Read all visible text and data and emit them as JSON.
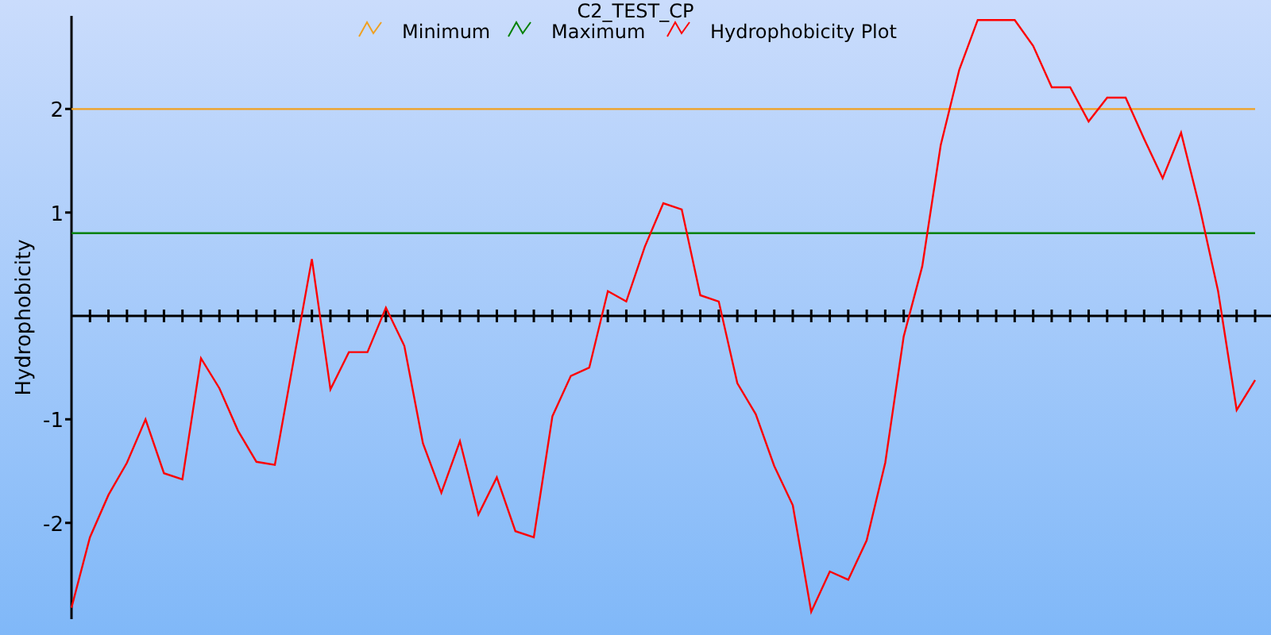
{
  "chart": {
    "chart_data": {
      "type": "line",
      "title": "C2_TEST_CP",
      "ylabel": "Hydrophobicity",
      "categories": [
        null,
        null,
        null,
        null,
        null,
        null,
        null,
        null,
        null,
        null,
        null,
        null,
        null,
        null,
        null,
        null,
        null,
        null,
        null,
        null,
        null,
        null,
        null,
        null,
        null,
        null,
        null,
        null,
        null,
        null,
        null,
        null,
        null,
        null,
        null,
        null,
        null,
        null,
        null,
        null,
        null,
        null,
        null,
        null,
        null,
        null,
        null,
        null,
        null,
        null,
        null,
        null,
        null,
        null,
        null,
        null,
        null,
        null,
        null,
        null,
        null,
        null,
        null,
        null,
        null
      ],
      "ylim": [
        -2.9,
        2.9
      ],
      "legend": "top",
      "yticks": [
        {
          "value": -2,
          "label": "-2"
        },
        {
          "value": -1,
          "label": "-1"
        },
        {
          "value": 1,
          "label": "1"
        },
        {
          "value": 2,
          "label": "2"
        }
      ],
      "series": [
        {
          "name": "Minimum",
          "color": "#f0a020",
          "values": [
            2,
            2,
            2,
            2,
            2,
            2,
            2,
            2,
            2,
            2,
            2,
            2,
            2,
            2,
            2,
            2,
            2,
            2,
            2,
            2,
            2,
            2,
            2,
            2,
            2,
            2,
            2,
            2,
            2,
            2,
            2,
            2,
            2,
            2,
            2,
            2,
            2,
            2,
            2,
            2,
            2,
            2,
            2,
            2,
            2,
            2,
            2,
            2,
            2,
            2,
            2,
            2,
            2,
            2,
            2,
            2,
            2,
            2,
            2,
            2,
            2,
            2,
            2,
            2,
            2
          ]
        },
        {
          "name": "Maximum",
          "color": "#008000",
          "values": [
            0.8,
            0.8,
            0.8,
            0.8,
            0.8,
            0.8,
            0.8,
            0.8,
            0.8,
            0.8,
            0.8,
            0.8,
            0.8,
            0.8,
            0.8,
            0.8,
            0.8,
            0.8,
            0.8,
            0.8,
            0.8,
            0.8,
            0.8,
            0.8,
            0.8,
            0.8,
            0.8,
            0.8,
            0.8,
            0.8,
            0.8,
            0.8,
            0.8,
            0.8,
            0.8,
            0.8,
            0.8,
            0.8,
            0.8,
            0.8,
            0.8,
            0.8,
            0.8,
            0.8,
            0.8,
            0.8,
            0.8,
            0.8,
            0.8,
            0.8,
            0.8,
            0.8,
            0.8,
            0.8,
            0.8,
            0.8,
            0.8,
            0.8,
            0.8,
            0.8,
            0.8,
            0.8,
            0.8,
            0.8,
            0.8
          ]
        },
        {
          "name": "Hydrophobicity Plot",
          "color": "#ff0000",
          "values": [
            -2.82,
            -2.14,
            -1.73,
            -1.42,
            -1.0,
            -1.52,
            -1.58,
            -0.41,
            -0.7,
            -1.11,
            -1.41,
            -1.44,
            -0.44,
            0.55,
            -0.71,
            -0.35,
            -0.35,
            0.08,
            -0.29,
            -1.23,
            -1.71,
            -1.21,
            -1.92,
            -1.56,
            -2.08,
            -2.14,
            -0.97,
            -0.58,
            -0.5,
            0.24,
            0.14,
            0.67,
            1.09,
            1.03,
            0.2,
            0.14,
            -0.65,
            -0.95,
            -1.45,
            -1.83,
            -2.86,
            -2.47,
            -2.55,
            -2.17,
            -1.42,
            -0.2,
            0.48,
            1.65,
            2.38,
            2.86,
            2.86,
            2.86,
            2.61,
            2.21,
            2.21,
            1.88,
            2.11,
            2.11,
            1.71,
            1.33,
            1.77,
            1.05,
            0.24,
            -0.91,
            -0.62
          ]
        }
      ]
    }
  }
}
